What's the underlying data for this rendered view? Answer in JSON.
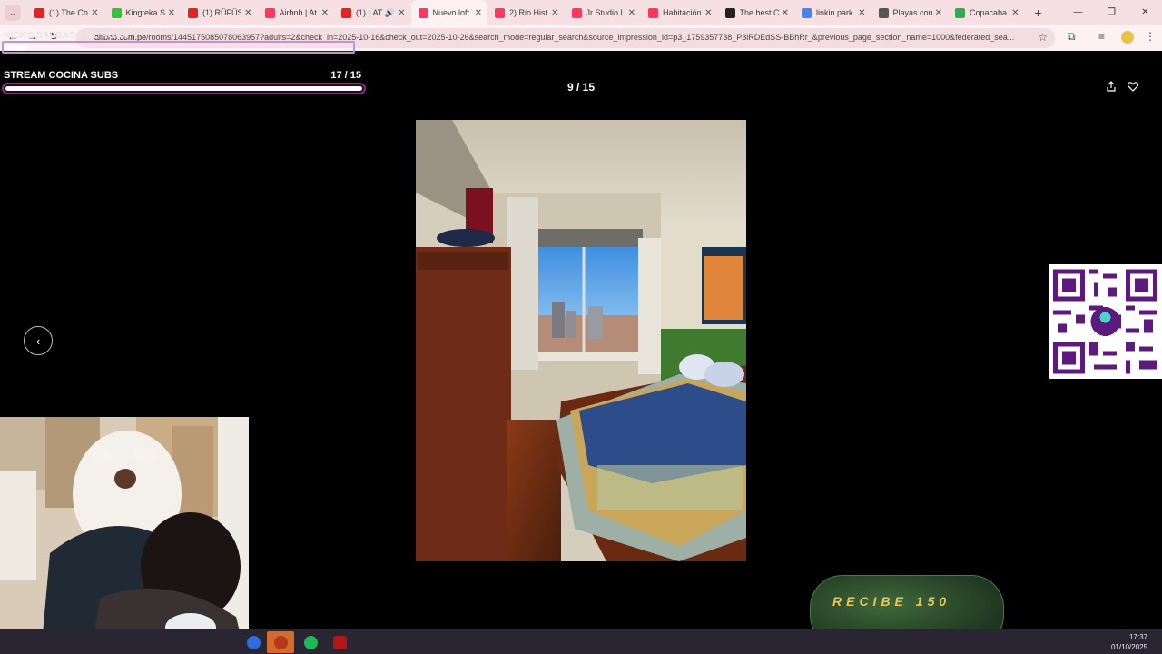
{
  "tabs": [
    {
      "title": "(1) The Chi",
      "favicon_color": "#e02424",
      "active": false
    },
    {
      "title": "Kingteka S",
      "favicon_color": "#32c43a",
      "active": false
    },
    {
      "title": "(1) RÜFÜS",
      "favicon_color": "#e02424",
      "active": false
    },
    {
      "title": "Airbnb | At",
      "favicon_color": "#ff385c",
      "active": false
    },
    {
      "title": "(1) LAT",
      "favicon_color": "#e02424",
      "active": false,
      "audio": true
    },
    {
      "title": "Nuevo loft",
      "favicon_color": "#ff385c",
      "active": true
    },
    {
      "title": "2) Rio Hist",
      "favicon_color": "#ff385c",
      "active": false
    },
    {
      "title": "Jr Studio L",
      "favicon_color": "#ff385c",
      "active": false
    },
    {
      "title": "Habitación",
      "favicon_color": "#ff385c",
      "active": false
    },
    {
      "title": "The best C",
      "favicon_color": "#222222",
      "active": false
    },
    {
      "title": "linkin park",
      "favicon_color": "#4285f4",
      "active": false
    },
    {
      "title": "Playas con",
      "favicon_color": "#555555",
      "active": false
    },
    {
      "title": "Copacaba",
      "favicon_color": "#34a853",
      "active": false
    }
  ],
  "address": {
    "host": "airbnb.com.pe",
    "path": "/rooms/1445175085078063957?adults=2&check_in=2025-10-16&check_out=2025-10-26&search_mode=regular_search&source_impression_id=p3_1759357738_P3iRDEdSS-BBhRr_&previous_page_section_name=1000&federated_sea..."
  },
  "overlay": {
    "kicks_label": "KICKS BALDASO DE AGUA",
    "kicks_progress": 0.06,
    "stream_label": "STREAM COCINA SUBS",
    "stream_count": "17  / 15",
    "stream_progress": 1.0
  },
  "gallery": {
    "counter": "9 / 15",
    "prev_glyph": "‹"
  },
  "recibe": {
    "text": "RECIBE 150"
  },
  "taskbar": {
    "time": "17:37",
    "date": "01/10/2025"
  },
  "icons": {
    "share": "share-icon",
    "heart": "heart-icon",
    "star": "bookmark-star-icon"
  }
}
